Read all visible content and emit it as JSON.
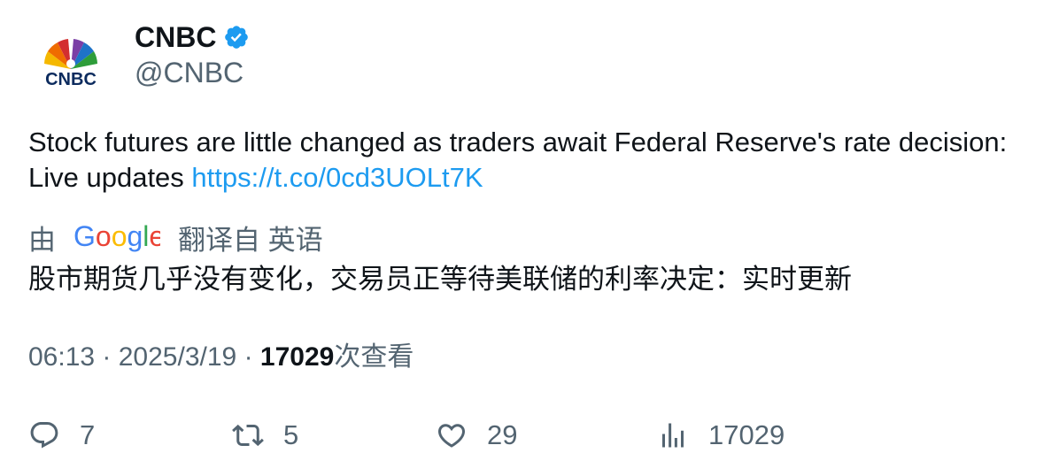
{
  "author": {
    "display_name": "CNBC",
    "handle": "@CNBC",
    "verified": true,
    "avatar_logo_text": "CNBC"
  },
  "tweet": {
    "text": "Stock futures are little changed as traders await Federal Reserve's rate decision: Live updates",
    "link": "https://t.co/0cd3UOLt7K",
    "link_color": "#1d9bf0"
  },
  "translation": {
    "by_label": "由",
    "provider": "Google",
    "from_label": "翻译自 英语",
    "text": "股市期货几乎没有变化，交易员正等待美联储的利率决定：实时更新"
  },
  "meta": {
    "time": "06:13",
    "separator": "·",
    "date": "2025/3/19",
    "views_count": "17029",
    "views_label": "次查看"
  },
  "actions": {
    "replies": "7",
    "retweets": "5",
    "likes": "29",
    "views": "17029"
  },
  "colors": {
    "text_primary": "#0f1419",
    "text_secondary": "#536471",
    "verified_badge": "#1d9bf0"
  }
}
